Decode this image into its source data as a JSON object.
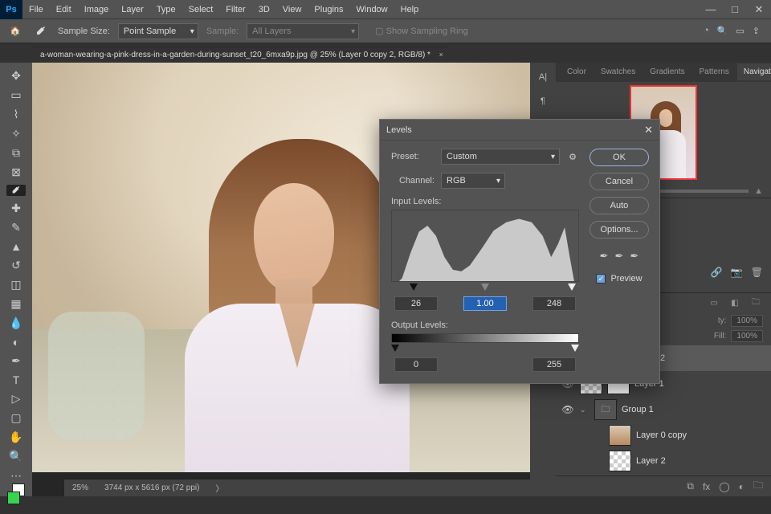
{
  "menu": {
    "items": [
      "File",
      "Edit",
      "Image",
      "Layer",
      "Type",
      "Select",
      "Filter",
      "3D",
      "View",
      "Plugins",
      "Window",
      "Help"
    ]
  },
  "optbar": {
    "sampleSizeLabel": "Sample Size:",
    "sampleSizeValue": "Point Sample",
    "sampleLabel": "Sample:",
    "sampleValue": "All Layers",
    "showSampling": "Show Sampling Ring"
  },
  "doc": {
    "tab": "a-woman-wearing-a-pink-dress-in-a-garden-during-sunset_t20_6mxa9p.jpg @ 25% (Layer 0 copy 2, RGB/8) *",
    "zoom": "25%",
    "dims": "3744 px x 5616 px (72 ppi)"
  },
  "panelTabs": [
    "Color",
    "Swatches",
    "Gradients",
    "Patterns",
    "Navigator"
  ],
  "layerOpts": {
    "opacityLabel": "ty:",
    "opacityVal": "100%",
    "fillLabel": "Fill:",
    "fillVal": "100%"
  },
  "layers": [
    {
      "name": "Layer 0 copy 2",
      "eye": true,
      "sel": true,
      "thumb": "photo"
    },
    {
      "name": "Layer 1",
      "eye": true,
      "thumb": "checker",
      "mask": true
    },
    {
      "name": "Group 1",
      "eye": true,
      "group": true,
      "open": true
    },
    {
      "name": "Layer 0 copy",
      "eye": false,
      "thumb": "photo",
      "indent": true
    },
    {
      "name": "Layer 2",
      "eye": false,
      "thumb": "checker",
      "indent": true
    }
  ],
  "levels": {
    "title": "Levels",
    "presetLabel": "Preset:",
    "presetValue": "Custom",
    "channelLabel": "Channel:",
    "channelValue": "RGB",
    "inputLabel": "Input Levels:",
    "inBlack": "26",
    "inGamma": "1.00",
    "inWhite": "248",
    "outputLabel": "Output Levels:",
    "outBlack": "0",
    "outWhite": "255",
    "ok": "OK",
    "cancel": "Cancel",
    "auto": "Auto",
    "options": "Options...",
    "preview": "Preview"
  }
}
